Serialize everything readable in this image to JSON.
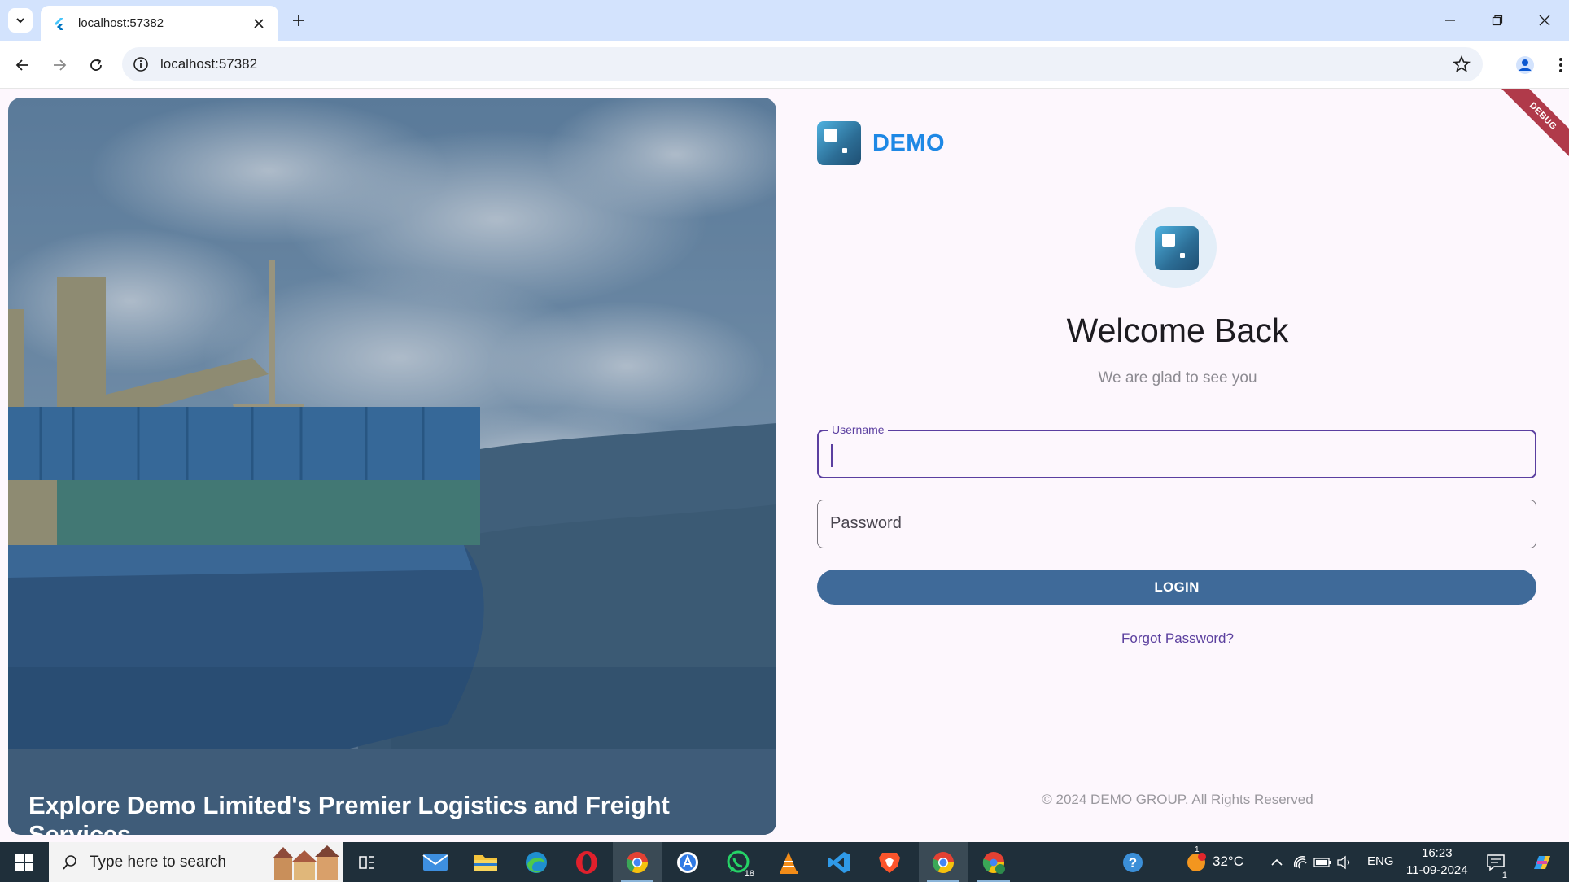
{
  "browser": {
    "tab_title": "localhost:57382",
    "url": "localhost:57382"
  },
  "app": {
    "brand_name": "DEMO",
    "debug_banner": "DEBUG",
    "hero_caption": "Explore Demo Limited's Premier Logistics and Freight Services",
    "welcome_title": "Welcome Back",
    "welcome_subtitle": "We are glad to see you",
    "username_label": "Username",
    "username_value": "",
    "password_placeholder": "Password",
    "login_label": "LOGIN",
    "forgot_label": "Forgot Password?",
    "copyright": "© 2024 DEMO GROUP. All Rights Reserved",
    "colors": {
      "primary": "#3f6a99",
      "focus_border": "#5b3fa0",
      "brand": "#1e88e5",
      "background": "#fdf7fd"
    }
  },
  "taskbar": {
    "search_placeholder": "Type here to search",
    "apps": [
      "task-view",
      "mail",
      "file-explorer",
      "edge",
      "opera",
      "chrome",
      "app-store",
      "whatsapp",
      "vlc",
      "vscode",
      "brave",
      "chrome-active",
      "chrome-profile"
    ],
    "whatsapp_badge": "18",
    "weather_temp": "32°C",
    "weather_badge": "1",
    "language": "ENG",
    "time": "16:23",
    "date": "11-09-2024",
    "notification_count": "1"
  }
}
